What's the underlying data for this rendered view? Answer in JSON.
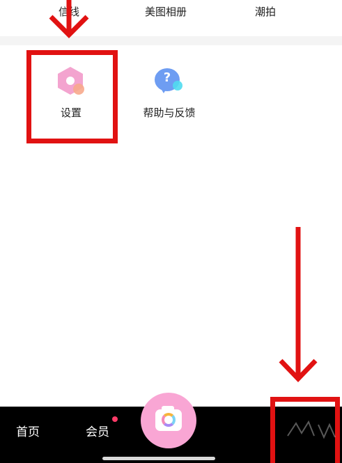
{
  "top_menu": {
    "items": [
      {
        "label": "信线"
      },
      {
        "label": "美图相册"
      },
      {
        "label": "潮拍"
      }
    ]
  },
  "tools": {
    "settings": {
      "label": "设置",
      "icon": "gear-hex-icon"
    },
    "help": {
      "label": "帮助与反馈",
      "icon": "help-bubble-icon",
      "glyph": "?"
    }
  },
  "tabbar": {
    "home": "首页",
    "vip": "会员",
    "photo": "",
    "profile": "",
    "camera_icon": "camera-icon"
  },
  "colors": {
    "annotation_red": "#e11212",
    "settings_pink": "#f3a4cf",
    "help_blue": "#6e9df2",
    "camera_pink": "#f9a6d4",
    "tabbar_bg": "#000000",
    "badge": "#ff3b68"
  }
}
